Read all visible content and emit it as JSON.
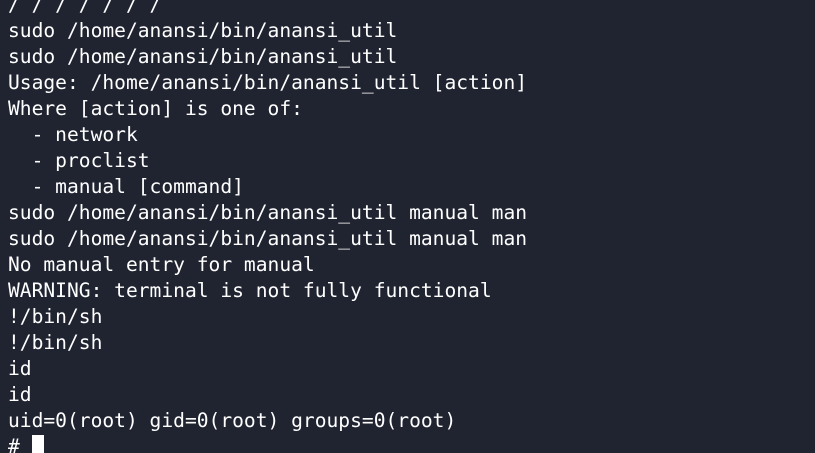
{
  "terminal": {
    "lines": [
      "/ / / / / / /",
      "sudo /home/anansi/bin/anansi_util",
      "sudo /home/anansi/bin/anansi_util",
      "Usage: /home/anansi/bin/anansi_util [action]",
      "Where [action] is one of:",
      "  - network",
      "  - proclist",
      "  - manual [command]",
      "sudo /home/anansi/bin/anansi_util manual man",
      "sudo /home/anansi/bin/anansi_util manual man",
      "No manual entry for manual",
      "WARNING: terminal is not fully functional",
      "!/bin/sh",
      "!/bin/sh",
      "id",
      "id",
      "uid=0(root) gid=0(root) groups=0(root)"
    ],
    "prompt": "# "
  },
  "colors": {
    "background": "#202431",
    "foreground": "#ffffff"
  }
}
